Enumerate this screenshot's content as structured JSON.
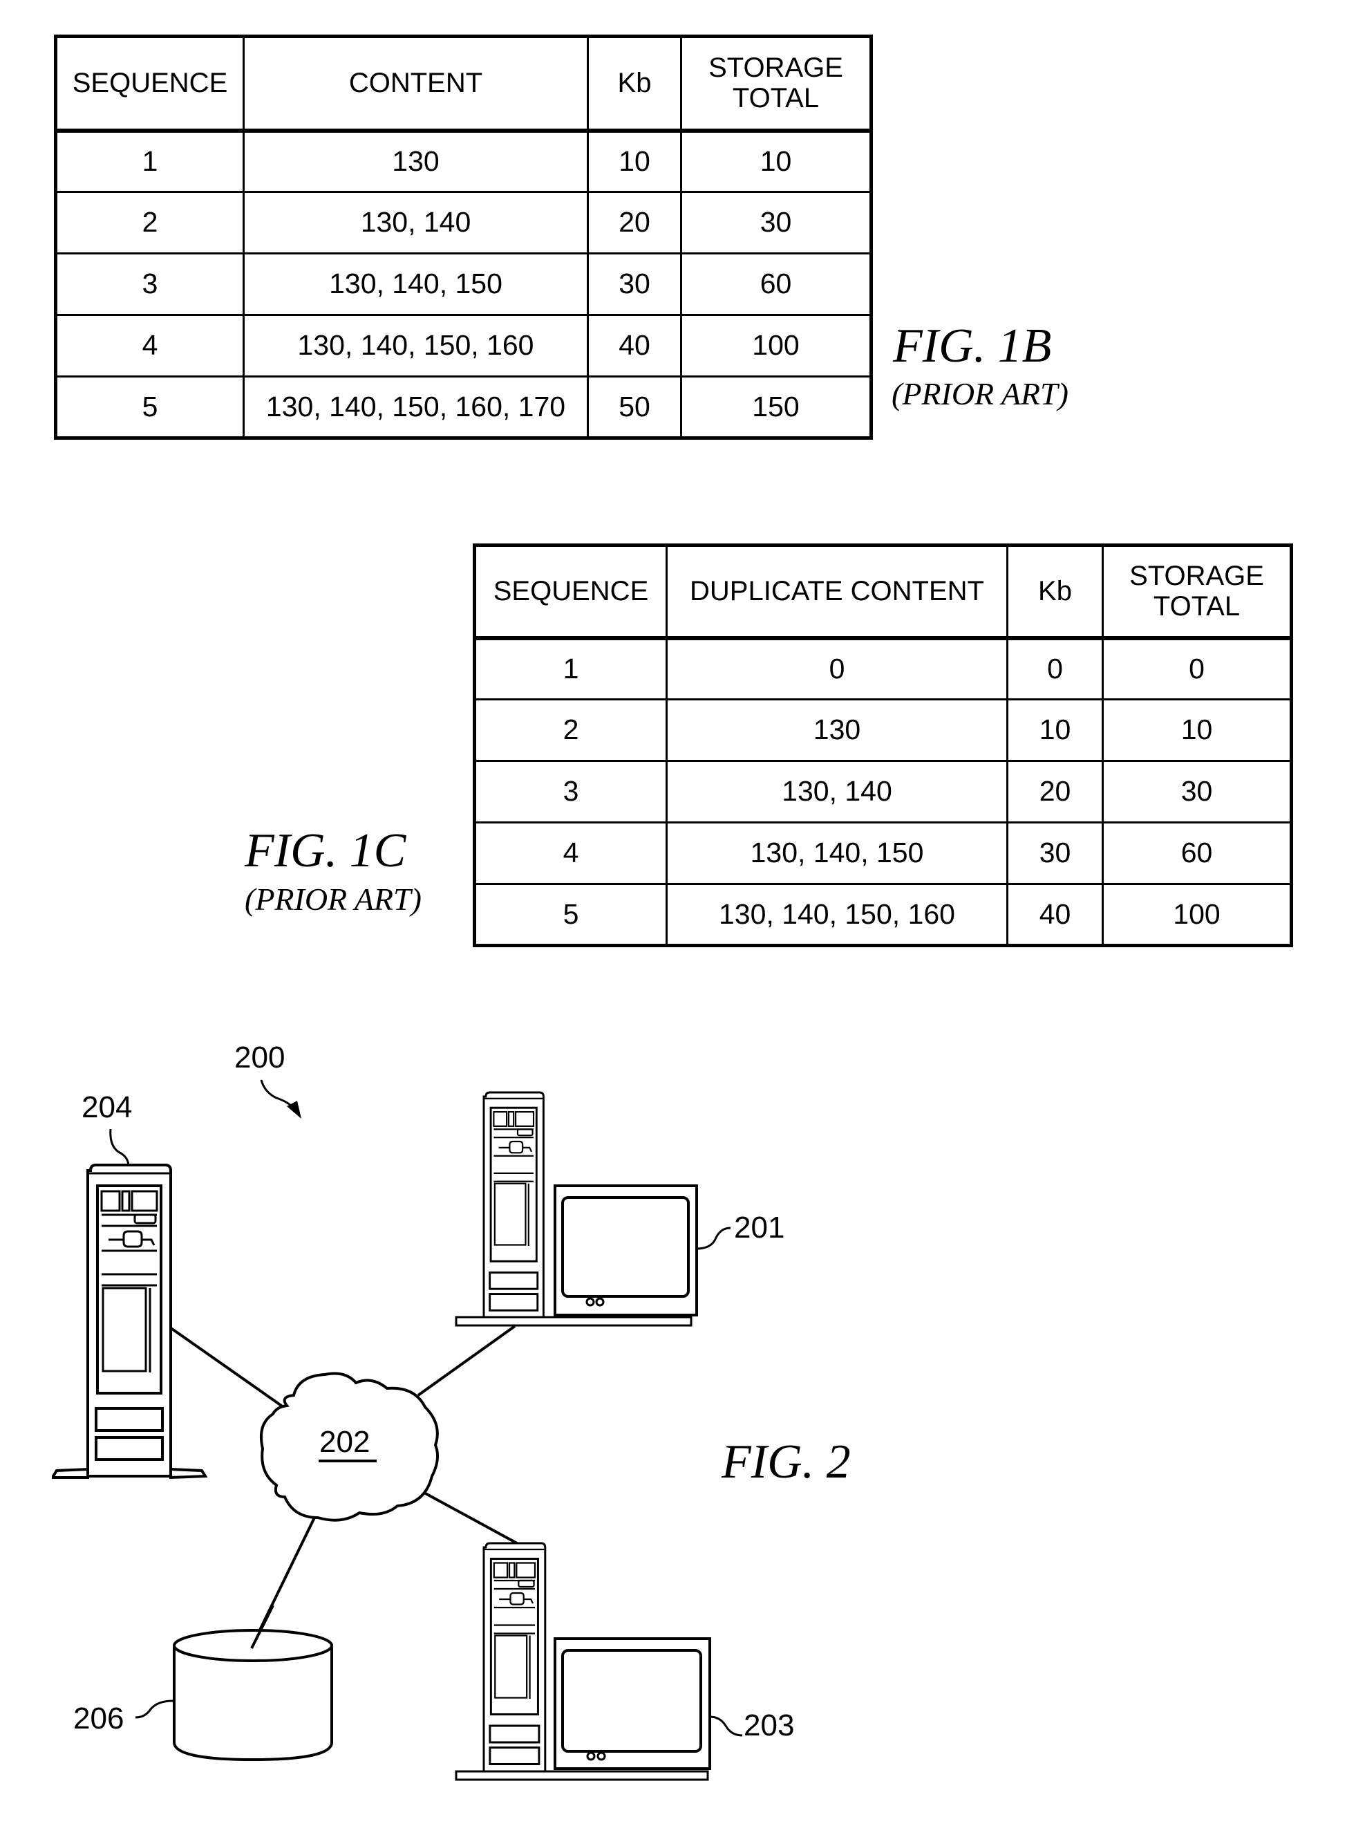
{
  "fig1b": {
    "label": "FIG. 1B",
    "sublabel": "(PRIOR ART)",
    "headers": [
      "SEQUENCE",
      "CONTENT",
      "Kb",
      "STORAGE TOTAL"
    ],
    "header_storage_line1": "STORAGE",
    "header_storage_line2": "TOTAL",
    "rows": [
      {
        "sequence": "1",
        "content": "130",
        "kb": "10",
        "storage_total": "10"
      },
      {
        "sequence": "2",
        "content": "130, 140",
        "kb": "20",
        "storage_total": "30"
      },
      {
        "sequence": "3",
        "content": "130, 140, 150",
        "kb": "30",
        "storage_total": "60"
      },
      {
        "sequence": "4",
        "content": "130, 140, 150, 160",
        "kb": "40",
        "storage_total": "100"
      },
      {
        "sequence": "5",
        "content": "130, 140, 150, 160, 170",
        "kb": "50",
        "storage_total": "150"
      }
    ]
  },
  "fig1c": {
    "label": "FIG. 1C",
    "sublabel": "(PRIOR ART)",
    "headers": [
      "SEQUENCE",
      "DUPLICATE CONTENT",
      "Kb",
      "STORAGE TOTAL"
    ],
    "header_storage_line1": "STORAGE",
    "header_storage_line2": "TOTAL",
    "rows": [
      {
        "sequence": "1",
        "content": "0",
        "kb": "0",
        "storage_total": "0"
      },
      {
        "sequence": "2",
        "content": "130",
        "kb": "10",
        "storage_total": "10"
      },
      {
        "sequence": "3",
        "content": "130, 140",
        "kb": "20",
        "storage_total": "30"
      },
      {
        "sequence": "4",
        "content": "130, 140, 150",
        "kb": "30",
        "storage_total": "60"
      },
      {
        "sequence": "5",
        "content": "130, 140, 150, 160",
        "kb": "40",
        "storage_total": "100"
      }
    ]
  },
  "fig2": {
    "label": "FIG. 2",
    "system_ref": "200",
    "nodes": [
      {
        "ref": "201",
        "type": "workstation"
      },
      {
        "ref": "202",
        "type": "network-cloud"
      },
      {
        "ref": "203",
        "type": "workstation"
      },
      {
        "ref": "204",
        "type": "server"
      },
      {
        "ref": "206",
        "type": "database"
      }
    ],
    "refs": {
      "r200": "200",
      "r201": "201",
      "r202": "202",
      "r203": "203",
      "r204": "204",
      "r206": "206"
    }
  }
}
